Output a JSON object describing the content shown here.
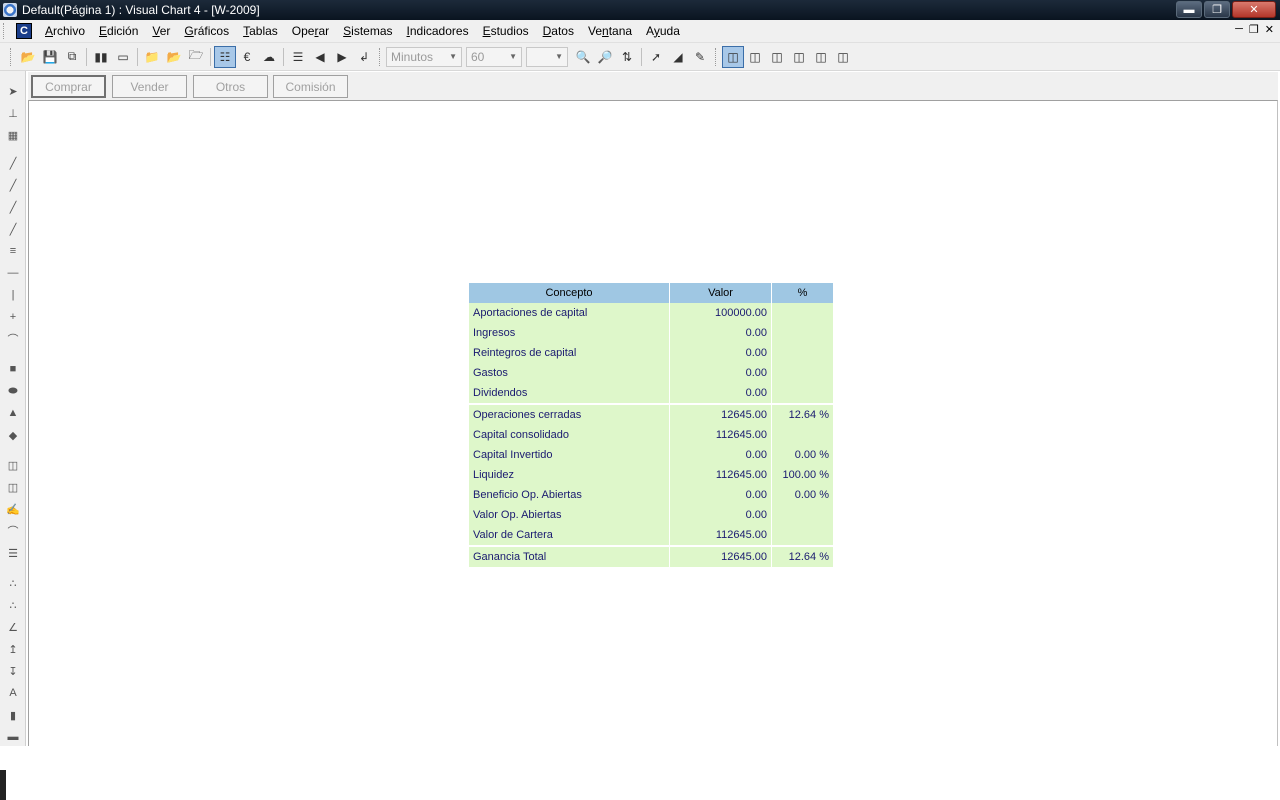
{
  "window": {
    "title": "Default(Página 1) : Visual Chart 4 - [W-2009]"
  },
  "menu": {
    "items": [
      {
        "pre": "",
        "acc": "A",
        "post": "rchivo"
      },
      {
        "pre": "",
        "acc": "E",
        "post": "dición"
      },
      {
        "pre": "",
        "acc": "V",
        "post": "er"
      },
      {
        "pre": "",
        "acc": "G",
        "post": "ráficos"
      },
      {
        "pre": "",
        "acc": "T",
        "post": "ablas"
      },
      {
        "pre": "Ope",
        "acc": "r",
        "post": "ar"
      },
      {
        "pre": "",
        "acc": "S",
        "post": "istemas"
      },
      {
        "pre": "",
        "acc": "I",
        "post": "ndicadores"
      },
      {
        "pre": "",
        "acc": "E",
        "post": "studios"
      },
      {
        "pre": "",
        "acc": "D",
        "post": "atos"
      },
      {
        "pre": "Ve",
        "acc": "n",
        "post": "tana"
      },
      {
        "pre": "A",
        "acc": "y",
        "post": "uda"
      }
    ]
  },
  "toolbar": {
    "timeframe_unit": "Minutos",
    "timeframe_value": "60",
    "third_select": ""
  },
  "trade_buttons": {
    "buy": "Comprar",
    "sell": "Vender",
    "others": "Otros",
    "commission": "Comisión"
  },
  "report": {
    "headers": [
      "Concepto",
      "Valor",
      "%"
    ],
    "group1": [
      {
        "concepto": "Aportaciones de capital",
        "valor": "100000.00",
        "pct": ""
      },
      {
        "concepto": "Ingresos",
        "valor": "0.00",
        "pct": ""
      },
      {
        "concepto": "Reintegros de capital",
        "valor": "0.00",
        "pct": ""
      },
      {
        "concepto": "Gastos",
        "valor": "0.00",
        "pct": ""
      },
      {
        "concepto": "Dividendos",
        "valor": "0.00",
        "pct": ""
      }
    ],
    "group2": [
      {
        "concepto": "Operaciones cerradas",
        "valor": "12645.00",
        "pct": "12.64 %"
      },
      {
        "concepto": "Capital consolidado",
        "valor": "112645.00",
        "pct": ""
      },
      {
        "concepto": "Capital Invertido",
        "valor": "0.00",
        "pct": "0.00 %"
      },
      {
        "concepto": "Liquidez",
        "valor": "112645.00",
        "pct": "100.00 %"
      },
      {
        "concepto": "Beneficio Op. Abiertas",
        "valor": "0.00",
        "pct": "0.00 %"
      },
      {
        "concepto": "Valor Op. Abiertas",
        "valor": "0.00",
        "pct": ""
      },
      {
        "concepto": "Valor de Cartera",
        "valor": "112645.00",
        "pct": ""
      }
    ],
    "total": {
      "concepto": "Ganancia Total",
      "valor": "12645.00",
      "pct": "12.64 %"
    }
  }
}
